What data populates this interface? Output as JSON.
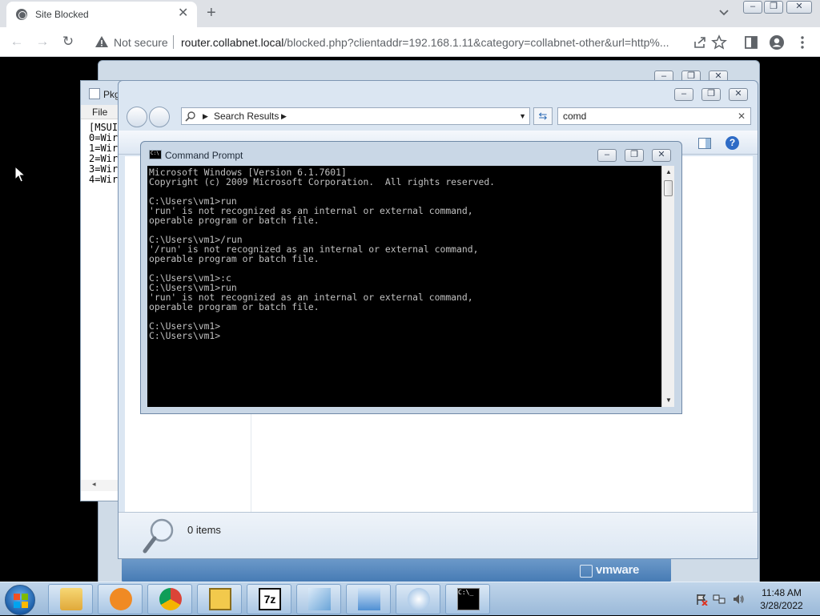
{
  "browser": {
    "tab_title": "Site Blocked",
    "tab_close": "✕",
    "new_tab": "+",
    "security_label": "Not secure",
    "url_host": "router.collabnet.local",
    "url_rest": "/blocked.php?clientaddr=192.168.1.11&category=collabnet-other&url=http%...",
    "window_controls": [
      "–",
      "❐",
      "✕"
    ]
  },
  "notepad": {
    "title": "Pkg",
    "menu_file": "File",
    "lines": [
      "[MSUI",
      "0=Wir",
      "1=Wir",
      "2=Wir",
      "3=Wir",
      "4=Wir"
    ],
    "scroll_left": "◂"
  },
  "explorer": {
    "breadcrumb": "Search Results",
    "search_query": "comd",
    "search_clear": "✕",
    "help": "?",
    "status_count": "0 items"
  },
  "cmd": {
    "title": "Command Prompt",
    "output": "Microsoft Windows [Version 6.1.7601]\nCopyright (c) 2009 Microsoft Corporation.  All rights reserved.\n\nC:\\Users\\vm1>run\n'run' is not recognized as an internal or external command,\noperable program or batch file.\n\nC:\\Users\\vm1>/run\n'/run' is not recognized as an internal or external command,\noperable program or batch file.\n\nC:\\Users\\vm1>:c\nC:\\Users\\vm1>run\n'run' is not recognized as an internal or external command,\noperable program or batch file.\n\nC:\\Users\\vm1>\nC:\\Users\\vm1>"
  },
  "vmware": {
    "logo_text": "vmware"
  },
  "taskbar": {
    "apps": [
      {
        "name": "windows-explorer",
        "color": "#e8b84a"
      },
      {
        "name": "media-player",
        "color": "#f08a24"
      },
      {
        "name": "chrome",
        "color": "#db4437"
      },
      {
        "name": "msi-package",
        "color": "#f2c94c"
      },
      {
        "name": "7zip",
        "color": "#111111"
      },
      {
        "name": "notepad",
        "color": "#6aa4d8"
      },
      {
        "name": "control-panel",
        "color": "#4f8fd3"
      },
      {
        "name": "installer",
        "color": "#8fb7e0"
      },
      {
        "name": "command-prompt",
        "color": "#000000"
      }
    ],
    "time": "11:48 AM",
    "date": "3/28/2022"
  }
}
